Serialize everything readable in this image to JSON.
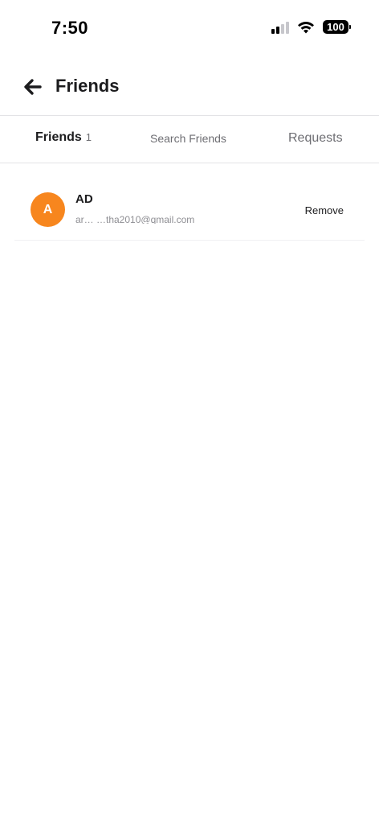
{
  "status_bar": {
    "time": "7:50",
    "battery": "100",
    "icons": [
      "cellular-signal-icon",
      "wifi-icon",
      "battery-icon"
    ]
  },
  "header": {
    "title": "Friends",
    "back_icon": "back-arrow-icon"
  },
  "tabs": {
    "friends_label": "Friends",
    "friends_count": "1",
    "search_label": "Search Friends",
    "requests_label": "Requests"
  },
  "friends": [
    {
      "initial": "A",
      "name": "AD",
      "email": "ar…  …tha2010@qmail.com",
      "remove_label": "Remove"
    }
  ],
  "colors": {
    "avatar": "#f7861e",
    "divider": "#e3e3e6"
  }
}
